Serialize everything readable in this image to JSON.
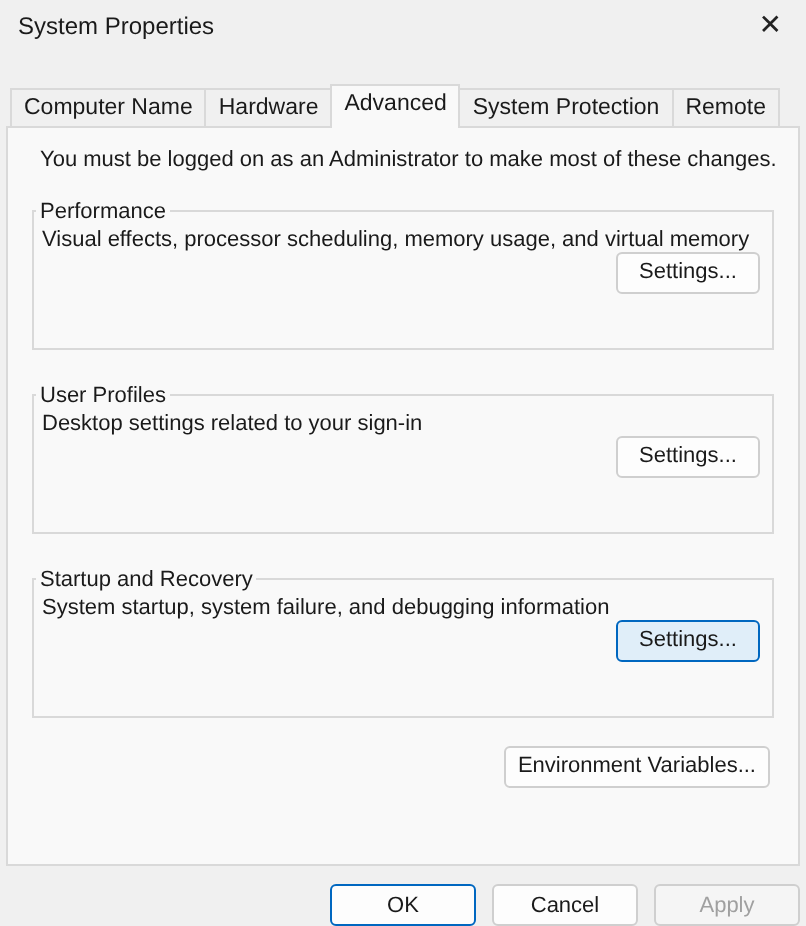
{
  "window": {
    "title": "System Properties",
    "close": "✕"
  },
  "tabs": [
    {
      "label": "Computer Name",
      "selected": false
    },
    {
      "label": "Hardware",
      "selected": false
    },
    {
      "label": "Advanced",
      "selected": true
    },
    {
      "label": "System Protection",
      "selected": false
    },
    {
      "label": "Remote",
      "selected": false
    }
  ],
  "notice": "You must be logged on as an Administrator to make most of these changes.",
  "groups": [
    {
      "title": "Performance",
      "description": "Visual effects, processor scheduling, memory usage, and virtual memory",
      "button": {
        "label": "Settings...",
        "highlighted": false
      }
    },
    {
      "title": "User Profiles",
      "description": "Desktop settings related to your sign-in",
      "button": {
        "label": "Settings...",
        "highlighted": false
      }
    },
    {
      "title": "Startup and Recovery",
      "description": "System startup, system failure, and debugging information",
      "button": {
        "label": "Settings...",
        "highlighted": true
      }
    }
  ],
  "environment_button": "Environment Variables...",
  "dialog_buttons": [
    {
      "label": "OK",
      "default": true,
      "disabled": false
    },
    {
      "label": "Cancel",
      "default": false,
      "disabled": false
    },
    {
      "label": "Apply",
      "default": false,
      "disabled": true
    }
  ]
}
